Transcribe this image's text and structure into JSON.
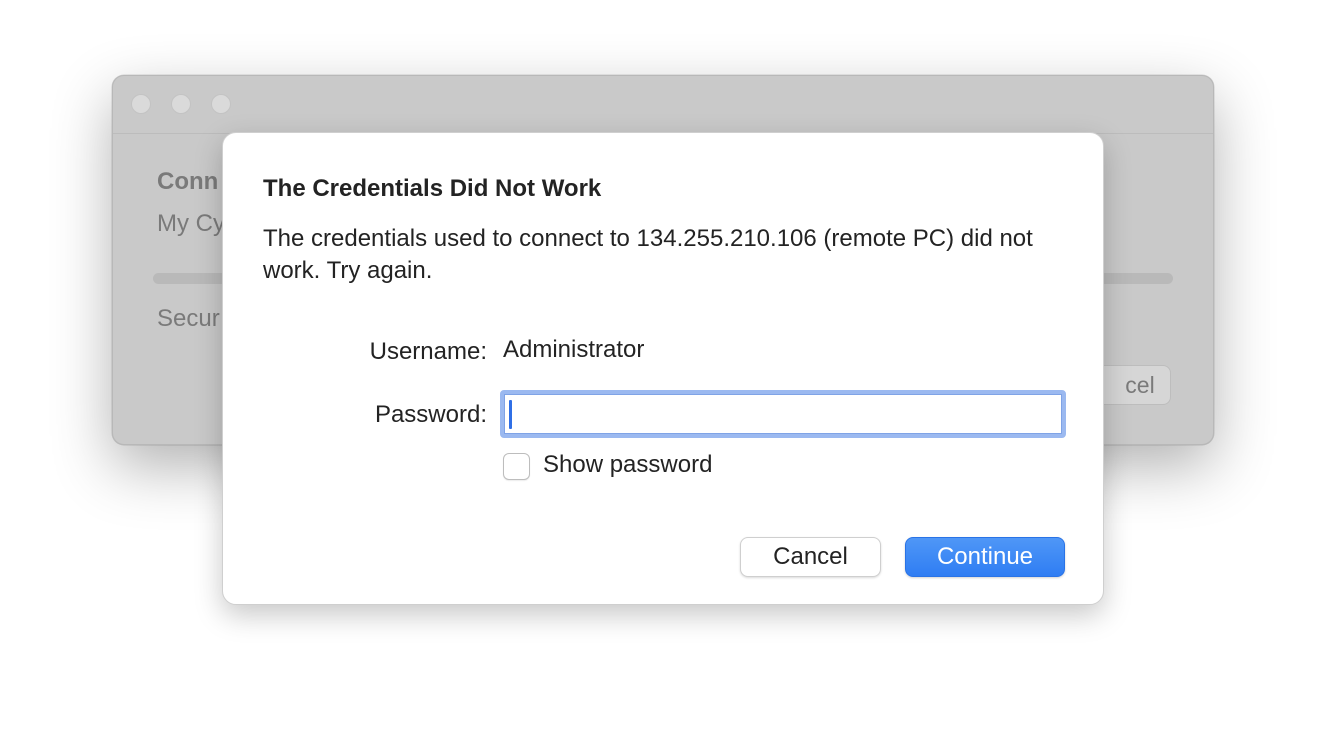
{
  "background_window": {
    "heading_partial": "Conn",
    "subtitle_partial": "My Cy",
    "security_partial": "Secur",
    "cancel_partial": "cel"
  },
  "dialog": {
    "title": "The Credentials Did Not Work",
    "message": "The credentials used to connect to 134.255.210.106 (remote PC) did not work. Try again.",
    "username_label": "Username:",
    "username_value": "Administrator",
    "password_label": "Password:",
    "password_value": "",
    "show_password_label": "Show password",
    "show_password_checked": false,
    "cancel_label": "Cancel",
    "continue_label": "Continue"
  },
  "colors": {
    "accent": "#2f7df3",
    "focus_ring": "#9bb9f0",
    "text": "#232323"
  }
}
